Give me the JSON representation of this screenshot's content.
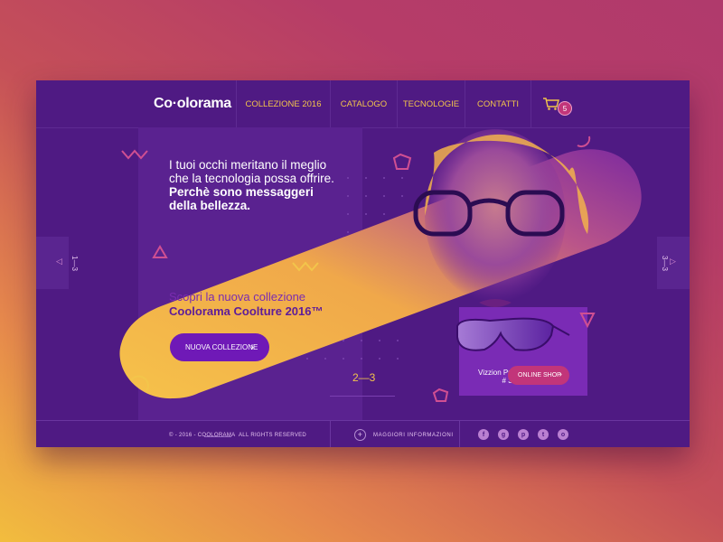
{
  "brand": {
    "logo": "Co·olorama"
  },
  "nav": {
    "items": [
      {
        "label": "COLLEZIONE 2016"
      },
      {
        "label": "CATALOGO"
      },
      {
        "label": "TECNOLOGIE"
      },
      {
        "label": "CONTATTI"
      }
    ],
    "cart_count": "5"
  },
  "hero": {
    "line1": "I tuoi occhi meritano il meglio",
    "line2": "che la tecnologia possa offrire.",
    "line3": "Perchè sono messaggeri",
    "line4": "della bellezza.",
    "sub1": "Scopri la nuova collezione",
    "sub2": "Coolorama Coolture 2016™",
    "cta_label": "NUOVA COLLEZIONE",
    "pager": "2—3"
  },
  "side": {
    "left_label": "1—3",
    "right_label": "3—3"
  },
  "product": {
    "name": "Vizzion Purple",
    "code": "# 3928",
    "shop_label": "ONLINE SHOP"
  },
  "footer": {
    "copyright": "© - 2016 - COOLORAMA",
    "rights": "ALL RIGHTS RESERVED",
    "more_info": "MAGGIORI INFORMAZIONI",
    "socials": [
      {
        "icon": "facebook-icon",
        "glyph": "f"
      },
      {
        "icon": "google-plus-icon",
        "glyph": "g"
      },
      {
        "icon": "pinterest-icon",
        "glyph": "p"
      },
      {
        "icon": "twitter-icon",
        "glyph": "t"
      },
      {
        "icon": "instagram-icon",
        "glyph": "o"
      }
    ]
  },
  "colors": {
    "card": "#4f1a83",
    "accent_yellow": "#f3c54b",
    "accent_pink": "#c2357a",
    "cta_purple": "#6f19b7"
  }
}
